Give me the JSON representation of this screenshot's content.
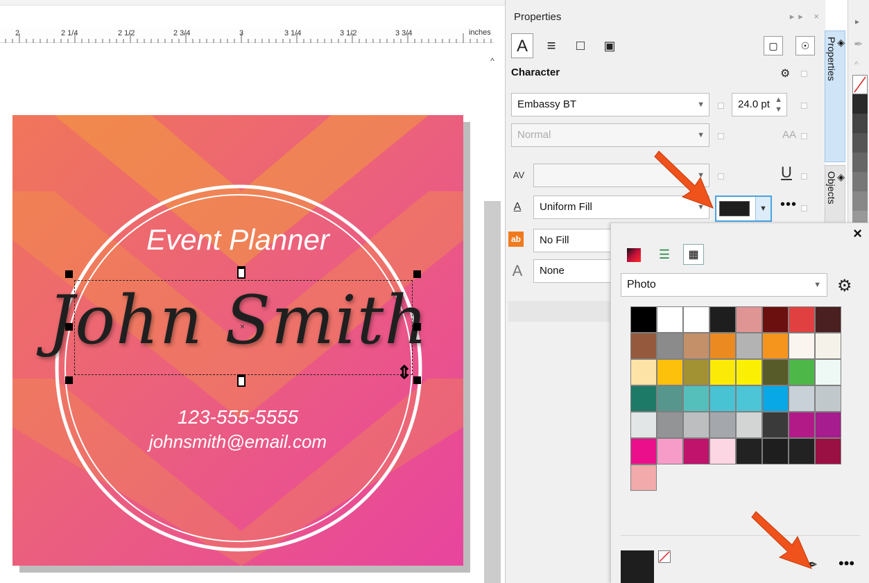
{
  "ruler": {
    "labels": [
      "2",
      "2 1/4",
      "2 1/2",
      "2 3/4",
      "3",
      "3 1/4",
      "3 1/2",
      "3 3/4"
    ],
    "units": "inches"
  },
  "card": {
    "title": "Event Planner",
    "name": "John Smith",
    "phone": "123-555-5555",
    "email": "johnsmith@email.com"
  },
  "panel": {
    "title": "Properties",
    "section_title": "Character",
    "font_name": "Embassy BT",
    "font_size": "24.0 pt",
    "font_style": "Normal",
    "fill_type": "Uniform Fill",
    "background_fill": "No Fill",
    "outline": "None",
    "vtab_properties": "Properties",
    "vtab_objects": "Objects"
  },
  "popup": {
    "palette_name": "Photo",
    "current_color": "#1e1e1e",
    "swatches": [
      "#000000",
      "#ffffff",
      "#ffffff",
      "#1e1e1e",
      "#e09595",
      "#6b0f0f",
      "#e04040",
      "#4a2020",
      "#955a3e",
      "#8b8b8b",
      "#c4906a",
      "#ec8a22",
      "#b3b3b3",
      "#f5951e",
      "#faf5ee",
      "#f5f2ea",
      "#fde3a6",
      "#fdc00b",
      "#a39234",
      "#fbe907",
      "#fbf003",
      "#575b29",
      "#4db748",
      "#eef8f5",
      "#1d7a66",
      "#57968c",
      "#54bfbb",
      "#48c3d3",
      "#4cc5d6",
      "#08a8e6",
      "#c8d1d8",
      "#c1c8cc",
      "#e3e6e7",
      "#929496",
      "#bcbebf",
      "#a4a8ad",
      "#d3d4d4",
      "#3a3a3a",
      "#b21a88",
      "#a71c8e",
      "#ec0f8c",
      "#f79cc8",
      "#bf136c",
      "#fcd6e2",
      "#222222",
      "#1e1e1e",
      "#222222",
      "#9b1042",
      "#f2aaab"
    ]
  },
  "strip": {
    "swatches": [
      "#ffffff",
      "#2a2a2a",
      "#444444",
      "#555555",
      "#666666",
      "#777777",
      "#888888",
      "#999999"
    ]
  },
  "colors": {
    "accent_arrow": "#f0521b",
    "selected_border": "#4aa3df"
  }
}
